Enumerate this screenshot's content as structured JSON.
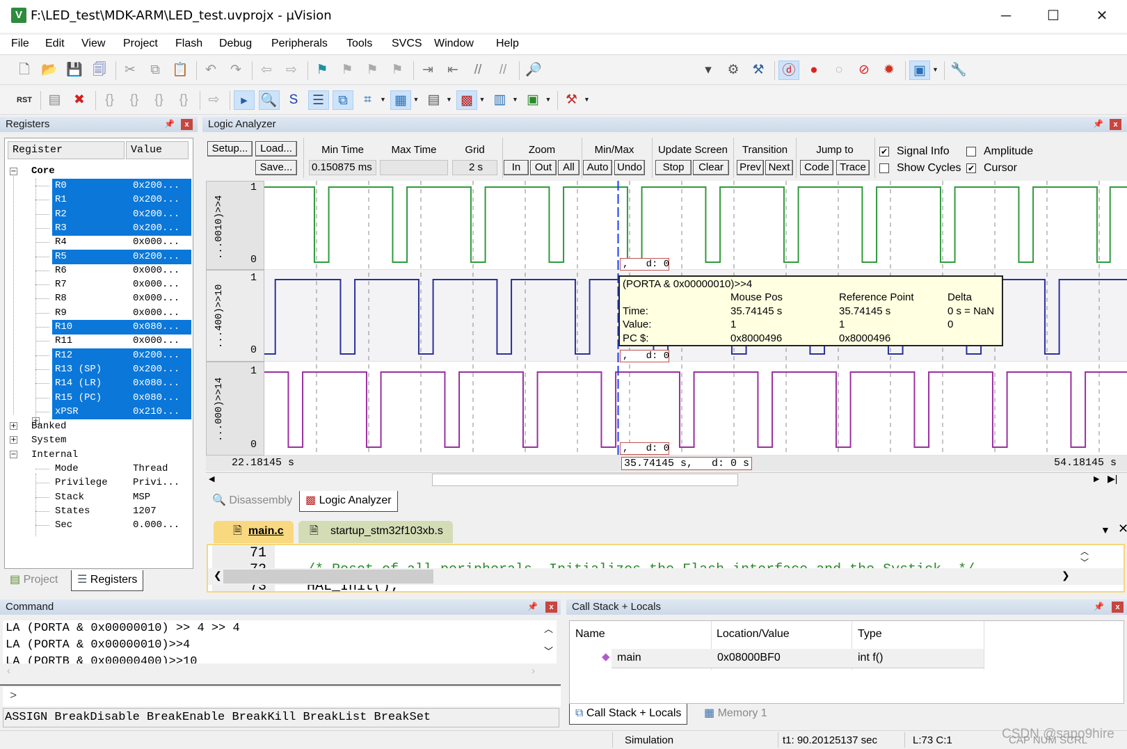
{
  "window": {
    "title": "F:\\LED_test\\MDK-ARM\\LED_test.uvprojx - µVision",
    "icon": "uvision-app-icon",
    "minimize": "─",
    "maximize": "☐",
    "close": "✕"
  },
  "menu": [
    "File",
    "Edit",
    "View",
    "Project",
    "Flash",
    "Debug",
    "Peripherals",
    "Tools",
    "SVCS",
    "Window",
    "Help"
  ],
  "toolbar1": {
    "left": [
      "new-file-icon",
      "open-folder-icon",
      "save-icon",
      "save-all-icon",
      "|",
      "cut-icon",
      "copy-icon",
      "paste-icon",
      "|",
      "undo-icon",
      "redo-icon",
      "|",
      "nav-back-icon",
      "nav-forward-icon",
      "|",
      "bookmark-icon",
      "bookmark-prev-icon",
      "bookmark-next-icon",
      "bookmark-clear-icon",
      "|",
      "indent-icon",
      "unindent-icon",
      "comment-icon",
      "uncomment-icon",
      "|",
      "find-in-files-icon"
    ],
    "right": [
      "target-combo-icon",
      "config-icon",
      "debug-tools-icon",
      "|",
      "debug-session-icon",
      "breakpoint-insert-icon",
      "breakpoint-enable-icon",
      "breakpoint-disable-icon",
      "breakpoint-kill-icon",
      "|",
      "window-layout-icon",
      "|",
      "wrench-icon"
    ]
  },
  "toolbar2": [
    "reset-rst-icon",
    "|",
    "run-icon",
    "stop-icon",
    "|",
    "step-into-icon",
    "step-over-icon",
    "step-out-icon",
    "run-to-cursor-icon",
    "|",
    "show-next-statement-icon",
    "|",
    "command-window-icon",
    "disassembly-window-icon",
    "symbols-window-icon",
    "registers-window-icon",
    "call-stack-window-icon",
    "watch-window-icon",
    "memory-window-icon",
    "serial-window-icon",
    "analysis-window-icon",
    "trace-window-icon",
    "system-viewer-icon",
    "|",
    "toolbox-icon"
  ],
  "registers": {
    "title": "Registers",
    "columns": [
      "Register",
      "Value"
    ],
    "core_label": "Core",
    "core": [
      {
        "name": "R0",
        "value": "0x200...",
        "selected": true
      },
      {
        "name": "R1",
        "value": "0x200...",
        "selected": true
      },
      {
        "name": "R2",
        "value": "0x200...",
        "selected": true
      },
      {
        "name": "R3",
        "value": "0x200...",
        "selected": true
      },
      {
        "name": "R4",
        "value": "0x000...",
        "selected": false
      },
      {
        "name": "R5",
        "value": "0x200...",
        "selected": true
      },
      {
        "name": "R6",
        "value": "0x000...",
        "selected": false
      },
      {
        "name": "R7",
        "value": "0x000...",
        "selected": false
      },
      {
        "name": "R8",
        "value": "0x000...",
        "selected": false
      },
      {
        "name": "R9",
        "value": "0x000...",
        "selected": false
      },
      {
        "name": "R10",
        "value": "0x080...",
        "selected": true
      },
      {
        "name": "R11",
        "value": "0x000...",
        "selected": false
      },
      {
        "name": "R12",
        "value": "0x200...",
        "selected": true
      },
      {
        "name": "R13 (SP)",
        "value": "0x200...",
        "selected": true
      },
      {
        "name": "R14 (LR)",
        "value": "0x080...",
        "selected": true
      },
      {
        "name": "R15 (PC)",
        "value": "0x080...",
        "selected": true
      },
      {
        "name": "xPSR",
        "value": "0x210...",
        "selected": true
      }
    ],
    "groups": [
      "Banked",
      "System",
      "Internal"
    ],
    "internal": [
      {
        "name": "Mode",
        "value": "Thread"
      },
      {
        "name": "Privilege",
        "value": "Privi..."
      },
      {
        "name": "Stack",
        "value": "MSP"
      },
      {
        "name": "States",
        "value": "1207"
      },
      {
        "name": "Sec",
        "value": "0.000..."
      }
    ],
    "tabs": [
      "Project",
      "Registers"
    ]
  },
  "logic_analyzer": {
    "title": "Logic Analyzer",
    "buttons": {
      "setup": "Setup...",
      "load": "Load...",
      "save": "Save...",
      "zoom_in": "In",
      "zoom_out": "Out",
      "zoom_all": "All",
      "auto": "Auto",
      "undo": "Undo",
      "stop": "Stop",
      "clear": "Clear",
      "prev": "Prev",
      "next": "Next",
      "code": "Code",
      "trace": "Trace"
    },
    "labels": {
      "min_time": "Min Time",
      "max_time": "Max Time",
      "grid": "Grid",
      "zoom": "Zoom",
      "minmax": "Min/Max",
      "update_screen": "Update Screen",
      "transition": "Transition",
      "jump_to": "Jump to"
    },
    "fields": {
      "min_time": "0.150875 ms",
      "max_time": "",
      "grid": "2 s"
    },
    "checkboxes": [
      {
        "label": "Signal Info",
        "checked": true
      },
      {
        "label": "Amplitude",
        "checked": false
      },
      {
        "label": "Show Cycles",
        "checked": false
      },
      {
        "label": "Cursor",
        "checked": true
      }
    ],
    "time_start": "22.18145 s",
    "time_end": "54.18145 s",
    "cursor_readout": "35.74145 s,   d: 0 s",
    "cursor_time": 35.74145,
    "view_start": 22.18145,
    "view_end": 54.18145,
    "grid_s": 2,
    "signals": [
      {
        "label": "...0010)>>4",
        "max": "1",
        "min": "0",
        "color": "#2e9a3a",
        "delta": ",   d: 0",
        "low_intervals": [
          [
            24.1,
            24.65
          ],
          [
            27.1,
            27.65
          ],
          [
            30.1,
            30.65
          ],
          [
            33.1,
            33.65
          ],
          [
            36.1,
            36.65
          ],
          [
            39.1,
            39.65
          ],
          [
            42.1,
            42.65
          ],
          [
            45.1,
            45.65
          ],
          [
            48.1,
            48.65
          ],
          [
            51.1,
            51.65
          ],
          [
            54.1,
            54.6
          ]
        ]
      },
      {
        "label": "...400)>>10",
        "max": "1",
        "min": "0",
        "color": "#2b2f9a",
        "delta": ",   d: 0",
        "low_intervals": [
          [
            22.18145,
            22.6
          ],
          [
            25.1,
            25.65
          ],
          [
            28.1,
            28.65
          ],
          [
            31.1,
            31.65
          ],
          [
            34.1,
            34.65
          ],
          [
            37.1,
            37.65
          ],
          [
            40.1,
            40.65
          ],
          [
            43.1,
            43.65
          ],
          [
            46.1,
            46.65
          ],
          [
            49.1,
            49.65
          ],
          [
            52.1,
            52.65
          ]
        ]
      },
      {
        "label": "...000)>>14",
        "max": "1",
        "min": "0",
        "color": "#9a2ea0",
        "delta": ",   d: 0",
        "low_intervals": [
          [
            23.1,
            23.65
          ],
          [
            26.1,
            26.65
          ],
          [
            29.1,
            29.65
          ],
          [
            32.1,
            32.65
          ],
          [
            35.1,
            35.65
          ],
          [
            38.1,
            38.65
          ],
          [
            41.1,
            41.65
          ],
          [
            44.1,
            44.65
          ],
          [
            47.1,
            47.65
          ],
          [
            50.1,
            50.65
          ],
          [
            53.1,
            53.65
          ]
        ]
      }
    ],
    "tooltip": {
      "expr": "(PORTA & 0x00000010)>>4",
      "headers": [
        "Mouse Pos",
        "Reference Point",
        "Delta"
      ],
      "rows": [
        {
          "label": "Time:",
          "mouse": "35.74145 s",
          "ref": "35.74145 s",
          "delta": "0 s = NaN"
        },
        {
          "label": "Value:",
          "mouse": "1",
          "ref": "1",
          "delta": "0"
        },
        {
          "label": "PC $:",
          "mouse": "0x8000496",
          "ref": "0x8000496",
          "delta": ""
        }
      ]
    },
    "tabs": [
      "Disassembly",
      "Logic Analyzer"
    ]
  },
  "editor": {
    "tabs": [
      "main.c",
      "startup_stm32f103xb.s"
    ],
    "lines": [
      {
        "num": "71",
        "text": ""
      },
      {
        "num": "72",
        "text": "  /* Reset of all peripherals, Initializes the Flash interface and the Systick. */"
      },
      {
        "num": "73",
        "text": "  HAL_Init();"
      }
    ]
  },
  "command": {
    "title": "Command",
    "history": [
      "LA (PORTA & 0x00000010) >> 4 >> 4",
      "LA (PORTA & 0x00000010)>>4",
      "LA (PORTB & 0x00000400)>>10"
    ],
    "prompt": ">",
    "input": "",
    "help": "ASSIGN BreakDisable BreakEnable BreakKill BreakList BreakSet"
  },
  "callstack": {
    "title": "Call Stack + Locals",
    "columns": [
      "Name",
      "Location/Value",
      "Type"
    ],
    "rows": [
      {
        "name": "main",
        "location": "0x08000BF0",
        "type": "int f()"
      }
    ],
    "tabs": [
      "Call Stack + Locals",
      "Memory 1"
    ]
  },
  "status": {
    "mode": "Simulation",
    "time": "t1: 90.20125137 sec",
    "position": "L:73 C:1",
    "keys": "CAP NUM SCRL",
    "watermark": "CSDN @sapo9hire"
  }
}
